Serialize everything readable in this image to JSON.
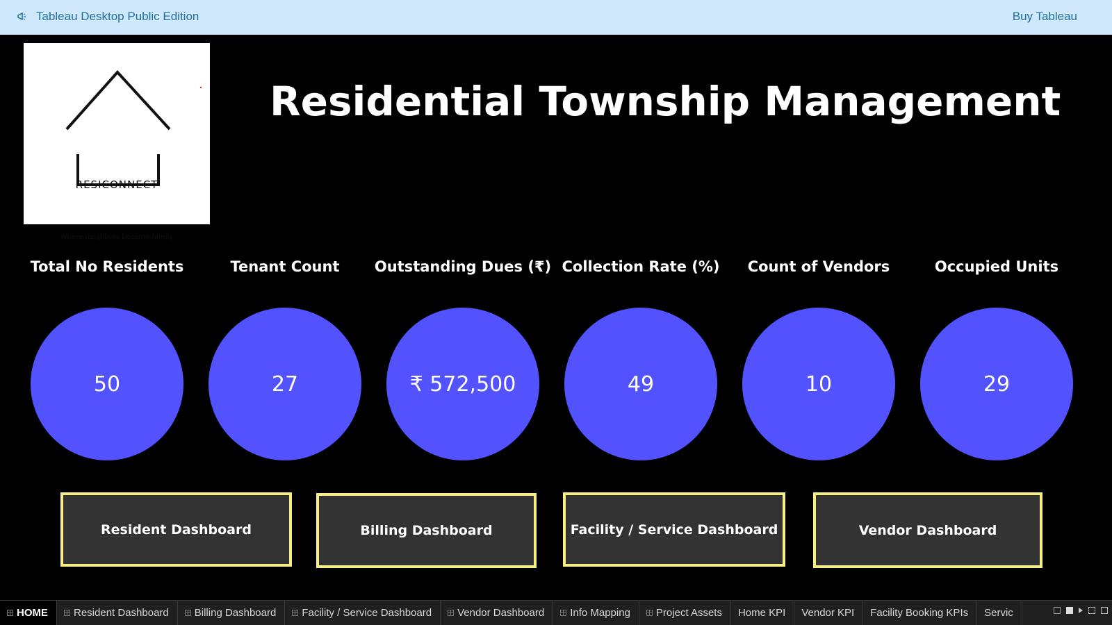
{
  "topbar": {
    "icon": "megaphone-icon",
    "title": "Tableau Desktop Public Edition",
    "buy_label": "Buy Tableau"
  },
  "logo": {
    "brand": "RESICONNECT",
    "tagline": "Where neighbors become family"
  },
  "title": "Residential Township Management",
  "kpis": [
    {
      "label": "Total No Residents",
      "value": "50"
    },
    {
      "label": "Tenant Count",
      "value": "27"
    },
    {
      "label": "Outstanding Dues (₹)",
      "value": "₹ 572,500"
    },
    {
      "label": "Collection Rate (%)",
      "value": "49"
    },
    {
      "label": "Count of Vendors",
      "value": "10"
    },
    {
      "label": "Occupied Units",
      "value": "29"
    }
  ],
  "nav_buttons": [
    {
      "label": "Resident Dashboard"
    },
    {
      "label": "Billing Dashboard"
    },
    {
      "label": "Facility / Service Dashboard"
    },
    {
      "label": "Vendor Dashboard"
    }
  ],
  "tabs": [
    {
      "label": "HOME"
    },
    {
      "label": "Resident Dashboard"
    },
    {
      "label": "Billing Dashboard"
    },
    {
      "label": "Facility / Service Dashboard"
    },
    {
      "label": "Vendor Dashboard"
    },
    {
      "label": "Info Mapping"
    },
    {
      "label": "Project Assets"
    },
    {
      "label": "Home KPI"
    },
    {
      "label": "Vendor KPI"
    },
    {
      "label": "Facility Booking KPIs"
    },
    {
      "label": "Servic"
    }
  ],
  "colors": {
    "topbar_bg": "#cfe8fb",
    "kpi_circle": "#5252ff",
    "button_border": "#f6ef86",
    "button_bg": "#333333"
  }
}
